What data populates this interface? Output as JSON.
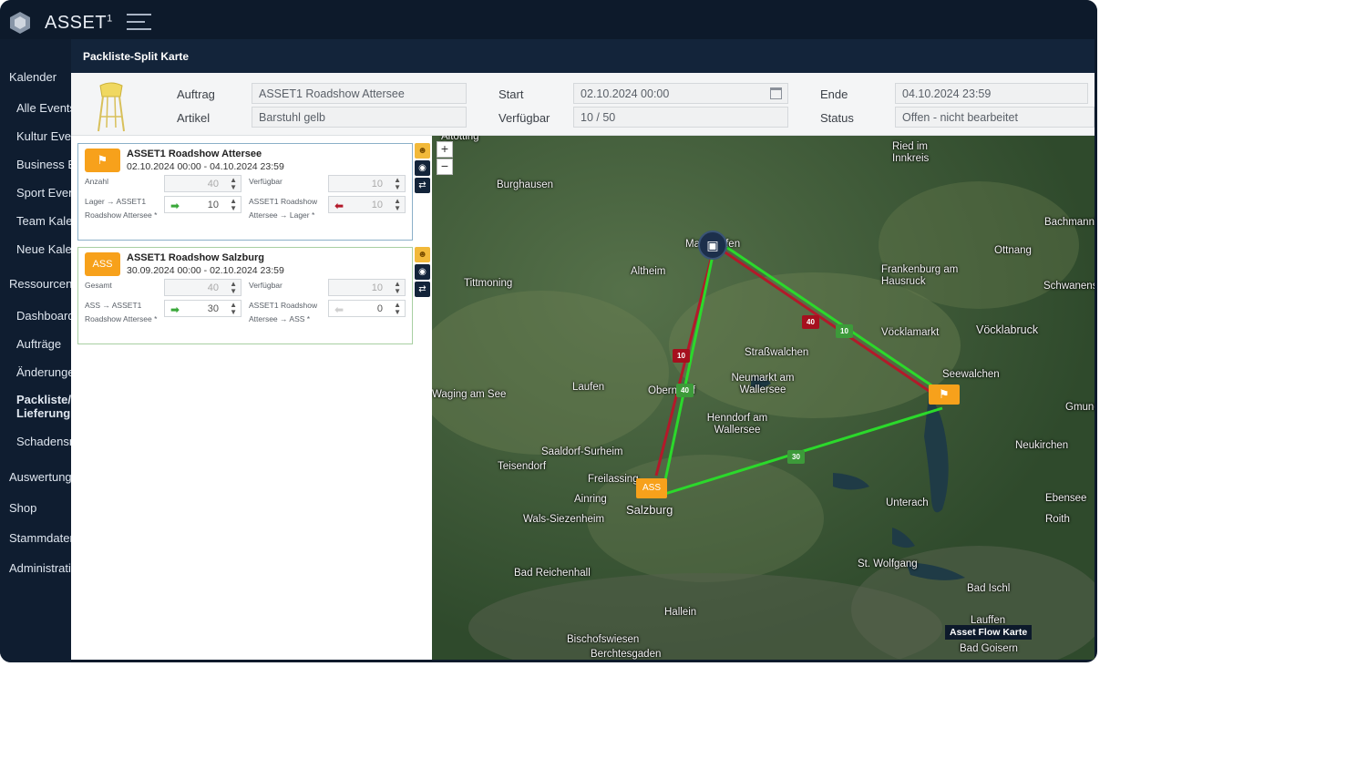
{
  "app": {
    "brand": "ASSET",
    "brand_sup": "1"
  },
  "sidebar": {
    "items": [
      {
        "label": "Kalender",
        "bold": false
      },
      {
        "label": "Alle Events",
        "bold": false
      },
      {
        "label": "Kultur Events",
        "bold": false
      },
      {
        "label": "Business Events",
        "bold": false
      },
      {
        "label": "Sport Events",
        "bold": false
      },
      {
        "label": "Team Kalender",
        "bold": false
      },
      {
        "label": "Neue Kalender",
        "bold": false
      },
      {
        "label": "Ressourcen",
        "bold": false
      },
      {
        "label": "Dashboard",
        "bold": false
      },
      {
        "label": "Aufträge",
        "bold": false
      },
      {
        "label": "Änderungen",
        "bold": false
      },
      {
        "label": "Packliste/",
        "bold": true
      },
      {
        "label": "Lieferung",
        "bold": true
      },
      {
        "label": "Schadensmeldung",
        "bold": false
      },
      {
        "label": "Auswertung",
        "bold": false
      },
      {
        "label": "Shop",
        "bold": false
      },
      {
        "label": "Stammdaten",
        "bold": false
      },
      {
        "label": "Administration",
        "bold": false
      }
    ]
  },
  "panel": {
    "title": "Packliste-Split Karte"
  },
  "form": {
    "auftrag_label": "Auftrag",
    "auftrag_value": "ASSET1 Roadshow Attersee",
    "artikel_label": "Artikel",
    "artikel_value": "Barstuhl gelb",
    "start_label": "Start",
    "start_value": "02.10.2024 00:00",
    "verfuegbar_label": "Verfügbar",
    "verfuegbar_value": "10 / 50",
    "ende_label": "Ende",
    "ende_value": "04.10.2024 23:59",
    "status_label": "Status",
    "status_value": "Offen - nicht bearbeitet"
  },
  "cards": [
    {
      "title": "ASSET1 Roadshow Attersee",
      "date": "02.10.2024 00:00 - 04.10.2024 23:59",
      "qty_label": "Anzahl",
      "qty_value": "40",
      "avail_label": "Verfügbar",
      "avail_value": "10",
      "out_label": "Lager → ASSET1 Roadshow Attersee *",
      "out_value": "10",
      "in_label": "ASSET1 Roadshow Attersee → Lager *",
      "in_value": "10"
    },
    {
      "badge": "ASS",
      "title": "ASSET1 Roadshow Salzburg",
      "date": "30.09.2024 00:00 - 02.10.2024 23:59",
      "qty_label": "Gesamt",
      "qty_value": "40",
      "avail_label": "Verfügbar",
      "avail_value": "10",
      "out_label": "ASS → ASSET1 Roadshow Attersee *",
      "out_value": "30",
      "in_label": "ASSET1 Roadshow Attersee → ASS *",
      "in_value": "0"
    }
  ],
  "map": {
    "places": [
      "Altötting",
      "Burghausen",
      "Tittmoning",
      "Altheim",
      "Mattighofen",
      "Ried im Innkreis",
      "Ottnang",
      "Bachmanning",
      "Frankenburg am Hausruck",
      "Schwanenstadt",
      "Vöcklamarkt",
      "Vöcklabruck",
      "Seewalchen",
      "Straßwalchen",
      "Neumarkt am Wallersee",
      "Oberndorf",
      "Laufen",
      "Waging am See",
      "Henndorf am Wallersee",
      "Saaldorf-Surheim",
      "Teisendorf",
      "Freilassing",
      "Ainring",
      "Salzburg",
      "Wals-Siezenheim",
      "Neukirchen",
      "Unterach",
      "Ebensee",
      "Roith",
      "St. Wolfgang",
      "Bad Ischl",
      "Bad Reichenhall",
      "Hallein",
      "Bischofswiesen",
      "Berchtesgaden",
      "Lauffen",
      "Bad Goisern",
      "Gmunden"
    ],
    "flow_values": [
      "40",
      "10",
      "10",
      "40",
      "30"
    ],
    "pin_ass": "ASS",
    "badge": "Asset Flow Karte",
    "colors": {
      "outgoing": "#2bd92b",
      "return": "#b3192a",
      "pin": "#f7a11b"
    }
  }
}
